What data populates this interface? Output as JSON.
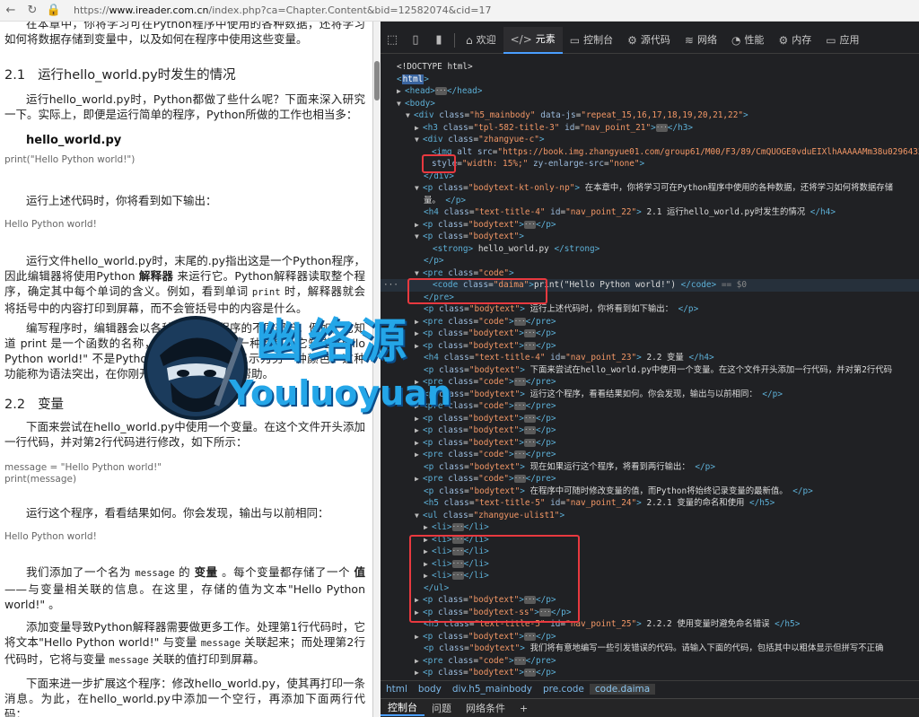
{
  "browser": {
    "back": "←",
    "refresh": "↻",
    "url_prefix": "https://",
    "url_host": "www.ireader.com.cn",
    "url_path": "/index.php?ca=Chapter.Content&bid=12582074&cid=17"
  },
  "reader": {
    "intro": "在本章中，你将学习可在Python程序中使用的各种数据，还将学习如何将数据存储到变量中，以及如何在程序中使用这些变量。",
    "s1_num": "2.1",
    "s1_title": "运行hello_world.py时发生的情况",
    "p1": "运行hello_world.py时，Python都做了些什么呢？下面来深入研究一下。实际上，即便是运行简单的程序，Python所做的工作也相当多：",
    "file1": "hello_world.py",
    "code1": "print(\"Hello Python world!\")",
    "p2": "运行上述代码时，你将看到如下输出：",
    "out1": "Hello Python world!",
    "p3a": "运行文件hello_world.py时，末尾的.py指出这是一个Python程序，因此编辑器将使用Python ",
    "p3b": "解释器",
    "p3c": " 来运行它。Python解释器读取整个程序，确定其中每个单词的含义。例如，看到单词 ",
    "p3d": "print",
    "p3e": " 时，解释器就会将括号中的内容打印到屏幕，而不会管括号中的内容是什么。",
    "p4": "编写程序时，编辑器会以各种方式突出程序的不同部分。例如，它知道 print 是一个函数的名称，因此将其显示为一种颜色；它知道\"Hello Python world!\" 不是Python代码，因此将其显示为另一种颜色。这种功能称为语法突出，在你刚开始编写程序时很有帮助。",
    "s2_num": "2.2",
    "s2_title": "变量",
    "p5": "下面来尝试在hello_world.py中使用一个变量。在这个文件开头添加一行代码，并对第2行代码进行修改，如下所示：",
    "code2a": "message = \"Hello Python world!\"",
    "code2b": "print(message)",
    "p6": "运行这个程序，看看结果如何。你会发现，输出与以前相同：",
    "out2": "Hello Python world!",
    "p7a": "我们添加了一个名为 ",
    "p7b": "message",
    "p7c": " 的 ",
    "p7d": "变量",
    "p7e": " 。每个变量都存储了一个 ",
    "p7f": "值",
    "p7g": "——与变量相关联的信息。在这里，存储的值为文本\"Hello Python world!\" 。",
    "p8a": "添加变量导致Python解释器需要做更多工作。处理第1行代码时，它将文本\"Hello Python world!\" 与变量 ",
    "p8b": "message",
    "p8c": " 关联起来；而处理第2行代码时，它将与变量 ",
    "p8d": "message",
    "p8e": " 关联的值打印到屏幕。",
    "p9": "下面来进一步扩展这个程序：修改hello_world.py，使其再打印一条消息。为此，在hello_world.py中添加一个空行，再添加下面两行代码："
  },
  "devtools": {
    "tabs": [
      "欢迎",
      "元素",
      "控制台",
      "源代码",
      "网络",
      "性能",
      "内存",
      "应用"
    ],
    "active_tab": "元素",
    "tab_icons": [
      "⌂",
      "</>",
      "▭",
      "⚙",
      "≋",
      "◔",
      "⚙",
      "▭"
    ],
    "breadcrumbs": [
      "html",
      "body",
      "div.h5_mainbody",
      "pre.code",
      "code.daima"
    ],
    "drawer_tabs": [
      "控制台",
      "问题",
      "网络条件",
      "+"
    ],
    "lines": {
      "l0": "<!DOCTYPE html>",
      "l1": "html",
      "l2": "head",
      "l3": "body",
      "l4_cls": "h5_mainbody",
      "l4_attr": "data-js",
      "l4_val": "repeat_15,16,17,18,19,20,21,22",
      "l5_cls": "tpl-582-title-3",
      "l5_id": "nav_point_21",
      "l6_cls": "zhangyue-c",
      "l7_src": "https://book.img.zhangyue01.com/group61/M00/F3/89/CmQUOGE0vduEIXlhAAAAAMm38u029643291",
      "l7_alt": "alt",
      "l8_style": "width: 15%;",
      "l8_zy": "none",
      "l10_cls": "bodytext-kt-only-np",
      "l10_txt": "在本章中，你将学习可在Python程序中使用的各种数据，还将学习如何将数据存储",
      "l11_txt": "量。",
      "l12_cls": "text-title-4",
      "l12_id": "nav_point_22",
      "l12_txt": "2.1 运行hello_world.py时发生的情况",
      "l15_txt": "hello_world.py",
      "l19_code": "print(\"Hello Python world!\")",
      "l19_eq": "== $0",
      "l21_txt": "运行上述代码时，你将看到如下输出：",
      "l25_id": "nav_point_23",
      "l25_txt": "2.2 变量",
      "l26_txt": "下面来尝试在hello_world.py中使用一个变量。在这个文件开头添加一行代码，并对第2行代码",
      "l28_txt": "运行这个程序，看看结果如何。你会发现，输出与以前相同：",
      "l34_txt": "现在如果运行这个程序，将看到两行输出：",
      "l36_txt": "在程序中可随时修改变量的值，而Python将始终记录变量的最新值。",
      "l37_id": "nav_point_24",
      "l37_txt": "2.2.1 变量的命名和使用",
      "l38_cls": "zhangyue-ulist1",
      "l46_cls": "bodytext-ss",
      "l47_id": "nav_point_25",
      "l47_txt": "2.2.2 使用变量时避免命名错误",
      "l48_txt": "我们将有意地编写一些引发错误的代码。请输入下面的代码，包括其中以粗体显示但拼写不正确"
    }
  },
  "watermark": {
    "title": "幽络源",
    "subtitle": "Youluoyuan"
  }
}
